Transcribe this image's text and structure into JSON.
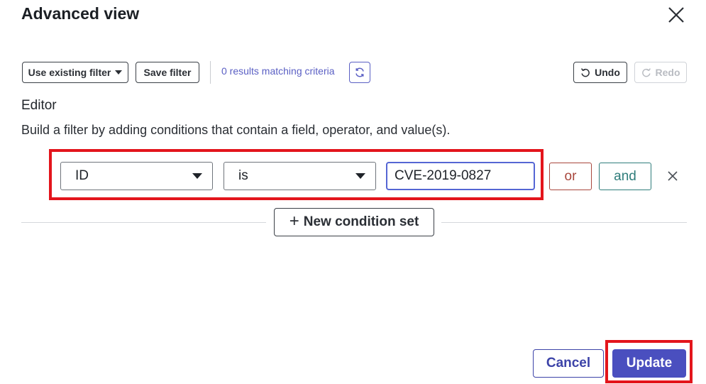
{
  "dialog": {
    "title": "Advanced view"
  },
  "toolbar": {
    "use_existing_filter": "Use existing filter",
    "save_filter": "Save filter",
    "results_text": "0 results matching criteria",
    "undo": "Undo",
    "redo": "Redo"
  },
  "editor": {
    "label": "Editor",
    "help_text": "Build a filter by adding conditions that contain a field, operator, and value(s).",
    "condition": {
      "field": "ID",
      "operator": "is",
      "value": "CVE-2019-0827"
    },
    "or_label": "or",
    "and_label": "and",
    "new_condition_set": "New condition set"
  },
  "footer": {
    "cancel": "Cancel",
    "update": "Update"
  },
  "colors": {
    "accent": "#4a4fbf",
    "highlight": "#e3151c",
    "or": "#a8463c",
    "and": "#2f7d7b"
  }
}
